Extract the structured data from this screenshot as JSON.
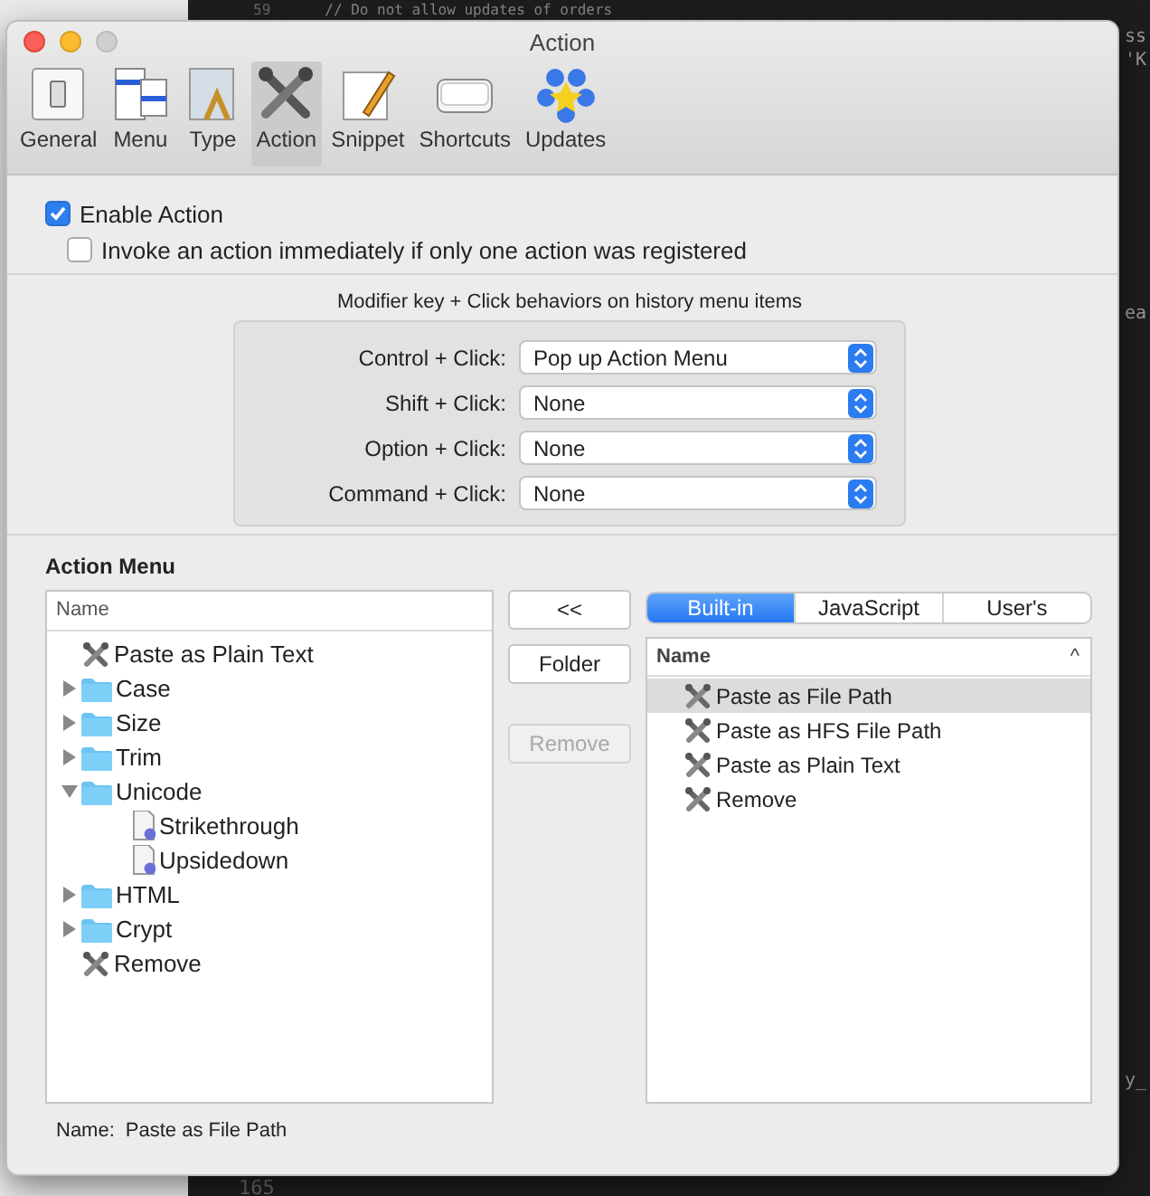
{
  "editor": {
    "lines": [
      {
        "number": "59",
        "code": "// Do not allow updates of orders"
      }
    ],
    "edge_fragments": [
      "ss",
      "'K",
      "ea",
      "y_"
    ],
    "bottom_number": "165"
  },
  "window": {
    "title": "Action"
  },
  "toolbar": {
    "tabs": [
      {
        "label": "General",
        "selected": false
      },
      {
        "label": "Menu",
        "selected": false
      },
      {
        "label": "Type",
        "selected": false
      },
      {
        "label": "Action",
        "selected": true
      },
      {
        "label": "Snippet",
        "selected": false
      },
      {
        "label": "Shortcuts",
        "selected": false
      },
      {
        "label": "Updates",
        "selected": false
      }
    ]
  },
  "options": [
    {
      "label": "Enable Action",
      "checked": true,
      "indented": false
    },
    {
      "label": "Invoke an action immediately if only one action was registered",
      "checked": false,
      "indented": true
    }
  ],
  "modifiers": {
    "caption": "Modifier key + Click behaviors on history menu items",
    "rows": [
      {
        "label": "Control + Click:",
        "value": "Pop up Action Menu"
      },
      {
        "label": "Shift + Click:",
        "value": "None"
      },
      {
        "label": "Option + Click:",
        "value": "None"
      },
      {
        "label": "Command + Click:",
        "value": "None"
      }
    ]
  },
  "action_menu": {
    "title": "Action Menu",
    "tree": {
      "header": "Name",
      "items": [
        {
          "kind": "action",
          "label": "Paste as Plain Text"
        },
        {
          "kind": "folder",
          "label": "Case",
          "expanded": false
        },
        {
          "kind": "folder",
          "label": "Size",
          "expanded": false
        },
        {
          "kind": "folder",
          "label": "Trim",
          "expanded": false
        },
        {
          "kind": "folder",
          "label": "Unicode",
          "expanded": true,
          "children": [
            {
              "kind": "script",
              "label": "Strikethrough"
            },
            {
              "kind": "script",
              "label": "Upsidedown"
            }
          ]
        },
        {
          "kind": "folder",
          "label": "HTML",
          "expanded": false
        },
        {
          "kind": "folder",
          "label": "Crypt",
          "expanded": false
        },
        {
          "kind": "action",
          "label": "Remove"
        }
      ]
    },
    "buttons": [
      {
        "label": "<<",
        "disabled": false
      },
      {
        "label": "Folder",
        "disabled": false
      },
      {
        "label": "Remove",
        "disabled": true
      }
    ],
    "segments": [
      {
        "label": "Built-in",
        "selected": true
      },
      {
        "label": "JavaScript",
        "selected": false
      },
      {
        "label": "User's",
        "selected": false
      }
    ],
    "list": {
      "header": "Name",
      "sort_indicator": "^",
      "rows": [
        {
          "label": "Paste as File Path",
          "selected": true
        },
        {
          "label": "Paste as HFS File Path",
          "selected": false
        },
        {
          "label": "Paste as Plain Text",
          "selected": false
        },
        {
          "label": "Remove",
          "selected": false
        }
      ]
    }
  },
  "footer": {
    "label": "Name:",
    "value": "Paste as File Path"
  }
}
